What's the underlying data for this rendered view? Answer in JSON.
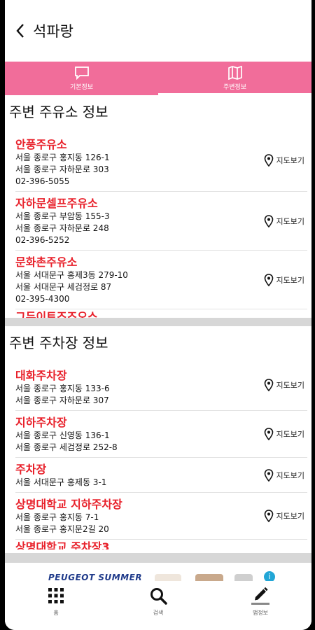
{
  "header": {
    "title": "석파랑",
    "back_icon": "chevron-left-icon"
  },
  "tabs": [
    {
      "label": "기본정보",
      "icon": "chat-bubble-icon",
      "active": false
    },
    {
      "label": "주변정보",
      "icon": "map-icon",
      "active": true
    }
  ],
  "gas": {
    "title": "주변 주유소 정보",
    "map_label": "지도보기",
    "items": [
      {
        "name": "안풍주유소",
        "addr1": "서울 종로구 홍지동 126-1",
        "addr2": "서울 종로구 자하문로 303",
        "phone": "02-396-5055"
      },
      {
        "name": "자하문셀프주유소",
        "addr1": "서울 종로구 부암동 155-3",
        "addr2": "서울 종로구 자하문로 248",
        "phone": "02-396-5252"
      },
      {
        "name": "문화촌주유소",
        "addr1": "서울 서대문구 홍제3동 279-10",
        "addr2": "서울 서대문구 세검정로 87",
        "phone": "02-395-4300"
      }
    ],
    "partial": "그두이트즈즈오스"
  },
  "parking": {
    "title": "주변 주차장 정보",
    "map_label": "지도보기",
    "items": [
      {
        "name": "대화주차장",
        "addr1": "서울 종로구 홍지동 133-6",
        "addr2": "서울 종로구 자하문로 307"
      },
      {
        "name": "지하주차장",
        "addr1": "서울 종로구 신영동 136-1",
        "addr2": "서울 종로구 세검정로 252-8"
      },
      {
        "name": "주차장",
        "addr1": "서울 서대문구 홍제동 3-1",
        "addr2": ""
      },
      {
        "name": "상명대학교 지하주차장",
        "addr1": "서울 종로구 홍지동 7-1",
        "addr2": "서울 종로구 홍지문2길 20"
      }
    ],
    "partial": "상명대학교 주차장3"
  },
  "ad": {
    "text": "PEUGEOT SUMMER"
  },
  "bottom_nav": [
    {
      "label": "홈",
      "icon": "grid-icon",
      "active": false
    },
    {
      "label": "검색",
      "icon": "search-icon",
      "active": false
    },
    {
      "label": "맵정보",
      "icon": "pencil-icon",
      "active": true
    }
  ],
  "colors": {
    "accent": "#f16d9a",
    "name_red": "#e8202a"
  }
}
